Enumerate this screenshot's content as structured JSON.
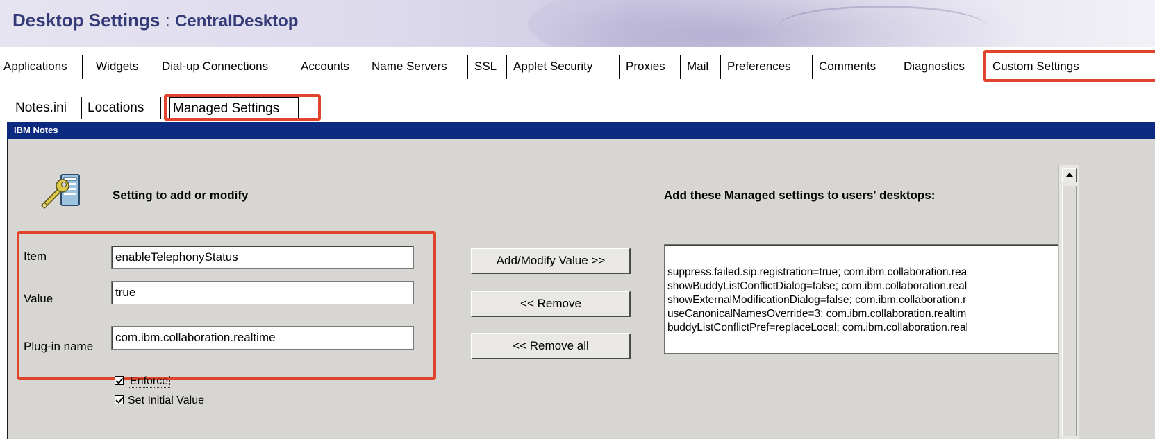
{
  "header": {
    "title": "Desktop Settings",
    "separator": ":",
    "subtitle": "CentralDesktop"
  },
  "top_tabs": [
    {
      "label": "Applications"
    },
    {
      "label": "Widgets"
    },
    {
      "label": "Dial-up Connections"
    },
    {
      "label": "Accounts"
    },
    {
      "label": "Name Servers"
    },
    {
      "label": "SSL"
    },
    {
      "label": "Applet Security"
    },
    {
      "label": "Proxies"
    },
    {
      "label": "Mail"
    },
    {
      "label": "Preferences"
    },
    {
      "label": "Comments"
    },
    {
      "label": "Diagnostics"
    },
    {
      "label": "Custom Settings"
    }
  ],
  "sub_tabs": [
    {
      "label": "Notes.ini"
    },
    {
      "label": "Locations"
    },
    {
      "label": "Managed Settings"
    }
  ],
  "panel": {
    "title": "IBM Notes",
    "setting_heading": "Setting to add or modify",
    "list_heading": "Add these Managed settings to users' desktops:"
  },
  "fields": {
    "item_label": "Item",
    "item_value": "enableTelephonyStatus",
    "value_label": "Value",
    "value_value": "true",
    "plugin_label": "Plug-in name",
    "plugin_value": "com.ibm.collaboration.realtime"
  },
  "buttons": {
    "add_modify": "Add/Modify Value >>",
    "remove": "<< Remove",
    "remove_all": "<< Remove all"
  },
  "checkboxes": {
    "enforce": "Enforce",
    "set_initial": "Set Initial Value"
  },
  "managed_list": [
    "suppress.failed.sip.registration=true; com.ibm.collaboration.rea",
    "showBuddyListConflictDialog=false; com.ibm.collaboration.real",
    "showExternalModificationDialog=false; com.ibm.collaboration.r",
    "useCanonicalNamesOverride=3; com.ibm.collaboration.realtim",
    "buddyListConflictPref=replaceLocal; com.ibm.collaboration.real"
  ],
  "colors": {
    "title_color": "#343a78",
    "highlight": "#e0452c",
    "panel_bar": "#0b2a80",
    "panel_bg": "#d8d6d2"
  }
}
